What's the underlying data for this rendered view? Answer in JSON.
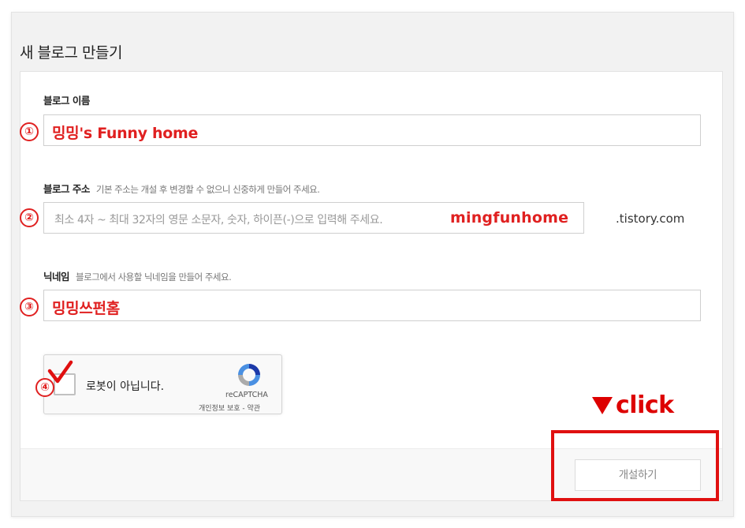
{
  "page": {
    "title": "새 블로그 만들기"
  },
  "form": {
    "blog_name": {
      "label": "블로그 이름",
      "value": "밍밍's Funny home",
      "marker": "①"
    },
    "blog_address": {
      "label": "블로그 주소",
      "hint": "기본 주소는 개설 후 변경할 수 없으니 신중하게 만들어 주세요.",
      "placeholder": "최소 4자 ~ 최대 32자의 영문 소문자, 숫자, 하이픈(-)으로 입력해 주세요.",
      "overlay_value": "mingfunhome",
      "suffix": ".tistory.com",
      "marker": "②"
    },
    "nickname": {
      "label": "닉네임",
      "hint": "블로그에서 사용할 닉네임을 만들어 주세요.",
      "value": "밍밍쓰펀홈",
      "marker": "③"
    },
    "recaptcha": {
      "label": "로봇이 아닙니다.",
      "brand": "reCAPTCHA",
      "terms": "개인정보 보호 - 약관",
      "checked": true,
      "marker": "④"
    }
  },
  "footer": {
    "create_button": "개설하기"
  },
  "annotation": {
    "click_note": "click",
    "color": "#e01010"
  }
}
